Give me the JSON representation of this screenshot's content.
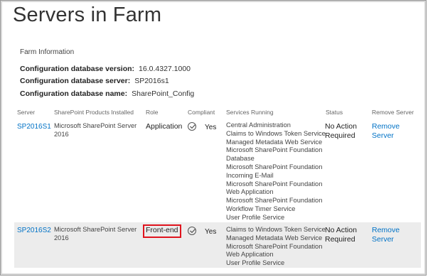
{
  "page": {
    "title": "Servers in Farm"
  },
  "farm": {
    "heading": "Farm Information",
    "config_version_label": "Configuration database version:",
    "config_version_value": "16.0.4327.1000",
    "config_server_label": "Configuration database server:",
    "config_server_value": "SP2016s1",
    "config_name_label": "Configuration database name:",
    "config_name_value": "SharePoint_Config"
  },
  "table": {
    "headers": [
      "Server",
      "SharePoint Products Installed",
      "Role",
      "Compliant",
      "Services Running",
      "Status",
      "Remove Server"
    ],
    "rows": [
      {
        "server": "SP2016S1",
        "products": [
          "Microsoft SharePoint Server",
          "2016"
        ],
        "role": "Application",
        "compliant": "Yes",
        "services": [
          "Central Administration",
          "Claims to Windows Token Service",
          "Managed Metadata Web Service",
          "Microsoft SharePoint Foundation",
          "Database",
          "Microsoft SharePoint Foundation",
          "Incoming E-Mail",
          "Microsoft SharePoint Foundation",
          "Web Application",
          "Microsoft SharePoint Foundation",
          "Workflow Timer Service",
          "User Profile Service"
        ],
        "status": [
          "No Action",
          "Required"
        ],
        "remove": [
          "Remove",
          "Server"
        ]
      },
      {
        "server": "SP2016S2",
        "products": [
          "Microsoft SharePoint Server",
          "2016"
        ],
        "role": "Front-end",
        "compliant": "Yes",
        "services": [
          "Claims to Windows Token Service",
          "Managed Metadata Web Service",
          "Microsoft SharePoint Foundation",
          "Web Application",
          "User Profile Service"
        ],
        "status": [
          "No Action",
          "Required"
        ],
        "remove": [
          "Remove",
          "Server"
        ]
      }
    ]
  },
  "colors": {
    "link": "#0072c6",
    "highlight": "#e0141e",
    "row_alt": "#ececec"
  },
  "icons": {
    "compliant": "check-circle-icon"
  }
}
